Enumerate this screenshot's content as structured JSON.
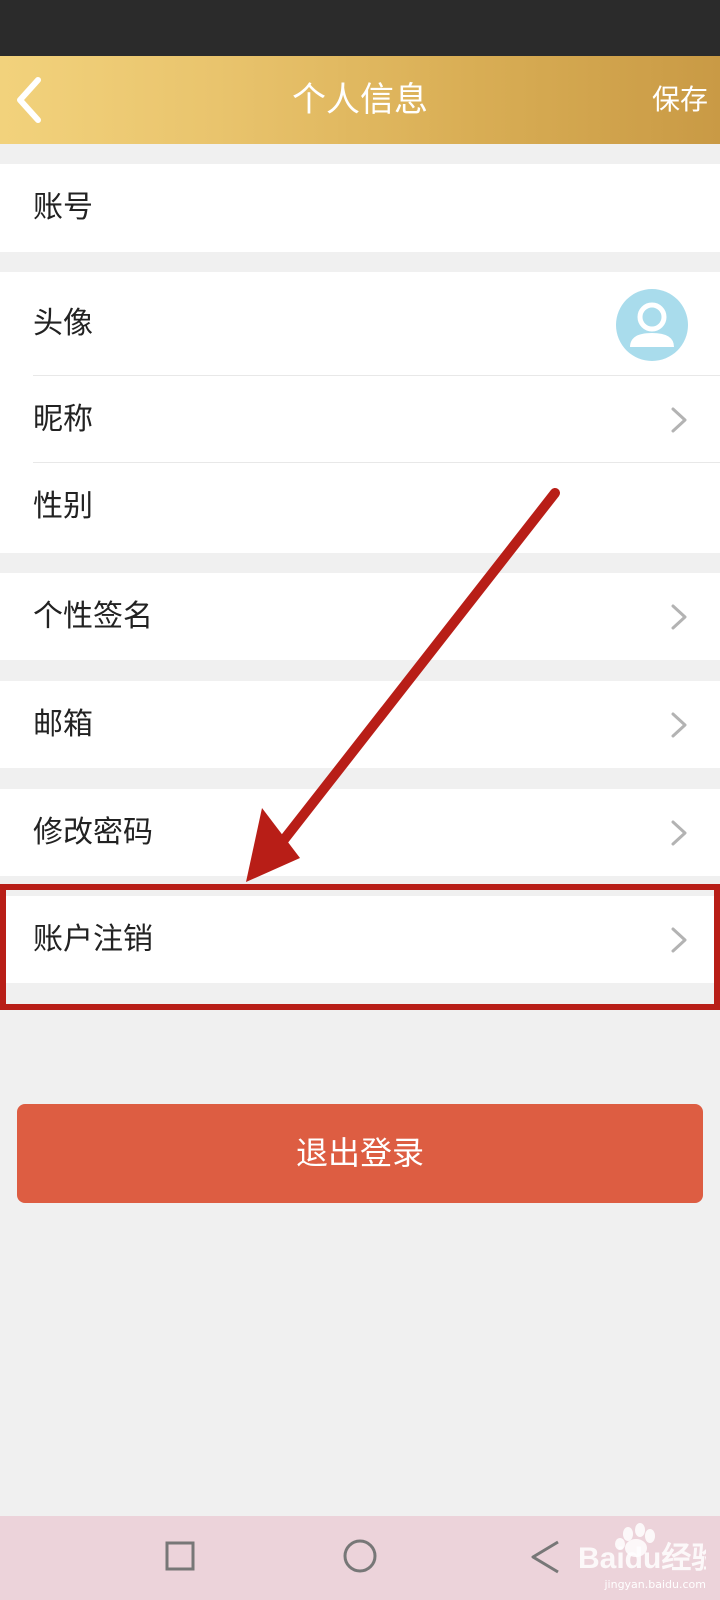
{
  "header": {
    "title": "个人信息",
    "save_label": "保存"
  },
  "account": {
    "label": "账号"
  },
  "profile": {
    "avatar_label": "头像",
    "nickname_label": "昵称",
    "gender_label": "性别"
  },
  "signature": {
    "label": "个性签名"
  },
  "email": {
    "label": "邮箱"
  },
  "password": {
    "label": "修改密码"
  },
  "deactivate": {
    "label": "账户注销"
  },
  "logout": {
    "label": "退出登录"
  },
  "watermark": {
    "brand": "Baidu经验",
    "url": "jingyan.baidu.com"
  },
  "colors": {
    "header_accent": "#e4bf66",
    "logout_button": "#dd5d42",
    "annotation_red": "#b81e17",
    "avatar": "#a9dcec"
  }
}
